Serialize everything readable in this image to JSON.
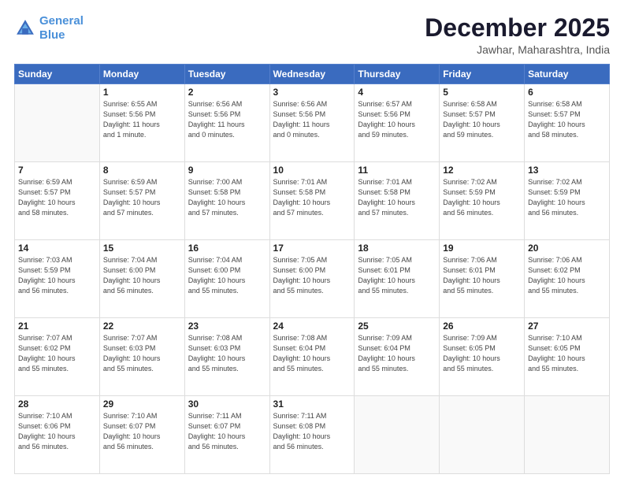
{
  "header": {
    "logo_line1": "General",
    "logo_line2": "Blue",
    "month": "December 2025",
    "location": "Jawhar, Maharashtra, India"
  },
  "weekdays": [
    "Sunday",
    "Monday",
    "Tuesday",
    "Wednesday",
    "Thursday",
    "Friday",
    "Saturday"
  ],
  "weeks": [
    [
      {
        "day": "",
        "detail": ""
      },
      {
        "day": "1",
        "detail": "Sunrise: 6:55 AM\nSunset: 5:56 PM\nDaylight: 11 hours\nand 1 minute."
      },
      {
        "day": "2",
        "detail": "Sunrise: 6:56 AM\nSunset: 5:56 PM\nDaylight: 11 hours\nand 0 minutes."
      },
      {
        "day": "3",
        "detail": "Sunrise: 6:56 AM\nSunset: 5:56 PM\nDaylight: 11 hours\nand 0 minutes."
      },
      {
        "day": "4",
        "detail": "Sunrise: 6:57 AM\nSunset: 5:56 PM\nDaylight: 10 hours\nand 59 minutes."
      },
      {
        "day": "5",
        "detail": "Sunrise: 6:58 AM\nSunset: 5:57 PM\nDaylight: 10 hours\nand 59 minutes."
      },
      {
        "day": "6",
        "detail": "Sunrise: 6:58 AM\nSunset: 5:57 PM\nDaylight: 10 hours\nand 58 minutes."
      }
    ],
    [
      {
        "day": "7",
        "detail": "Sunrise: 6:59 AM\nSunset: 5:57 PM\nDaylight: 10 hours\nand 58 minutes."
      },
      {
        "day": "8",
        "detail": "Sunrise: 6:59 AM\nSunset: 5:57 PM\nDaylight: 10 hours\nand 57 minutes."
      },
      {
        "day": "9",
        "detail": "Sunrise: 7:00 AM\nSunset: 5:58 PM\nDaylight: 10 hours\nand 57 minutes."
      },
      {
        "day": "10",
        "detail": "Sunrise: 7:01 AM\nSunset: 5:58 PM\nDaylight: 10 hours\nand 57 minutes."
      },
      {
        "day": "11",
        "detail": "Sunrise: 7:01 AM\nSunset: 5:58 PM\nDaylight: 10 hours\nand 57 minutes."
      },
      {
        "day": "12",
        "detail": "Sunrise: 7:02 AM\nSunset: 5:59 PM\nDaylight: 10 hours\nand 56 minutes."
      },
      {
        "day": "13",
        "detail": "Sunrise: 7:02 AM\nSunset: 5:59 PM\nDaylight: 10 hours\nand 56 minutes."
      }
    ],
    [
      {
        "day": "14",
        "detail": "Sunrise: 7:03 AM\nSunset: 5:59 PM\nDaylight: 10 hours\nand 56 minutes."
      },
      {
        "day": "15",
        "detail": "Sunrise: 7:04 AM\nSunset: 6:00 PM\nDaylight: 10 hours\nand 56 minutes."
      },
      {
        "day": "16",
        "detail": "Sunrise: 7:04 AM\nSunset: 6:00 PM\nDaylight: 10 hours\nand 55 minutes."
      },
      {
        "day": "17",
        "detail": "Sunrise: 7:05 AM\nSunset: 6:00 PM\nDaylight: 10 hours\nand 55 minutes."
      },
      {
        "day": "18",
        "detail": "Sunrise: 7:05 AM\nSunset: 6:01 PM\nDaylight: 10 hours\nand 55 minutes."
      },
      {
        "day": "19",
        "detail": "Sunrise: 7:06 AM\nSunset: 6:01 PM\nDaylight: 10 hours\nand 55 minutes."
      },
      {
        "day": "20",
        "detail": "Sunrise: 7:06 AM\nSunset: 6:02 PM\nDaylight: 10 hours\nand 55 minutes."
      }
    ],
    [
      {
        "day": "21",
        "detail": "Sunrise: 7:07 AM\nSunset: 6:02 PM\nDaylight: 10 hours\nand 55 minutes."
      },
      {
        "day": "22",
        "detail": "Sunrise: 7:07 AM\nSunset: 6:03 PM\nDaylight: 10 hours\nand 55 minutes."
      },
      {
        "day": "23",
        "detail": "Sunrise: 7:08 AM\nSunset: 6:03 PM\nDaylight: 10 hours\nand 55 minutes."
      },
      {
        "day": "24",
        "detail": "Sunrise: 7:08 AM\nSunset: 6:04 PM\nDaylight: 10 hours\nand 55 minutes."
      },
      {
        "day": "25",
        "detail": "Sunrise: 7:09 AM\nSunset: 6:04 PM\nDaylight: 10 hours\nand 55 minutes."
      },
      {
        "day": "26",
        "detail": "Sunrise: 7:09 AM\nSunset: 6:05 PM\nDaylight: 10 hours\nand 55 minutes."
      },
      {
        "day": "27",
        "detail": "Sunrise: 7:10 AM\nSunset: 6:05 PM\nDaylight: 10 hours\nand 55 minutes."
      }
    ],
    [
      {
        "day": "28",
        "detail": "Sunrise: 7:10 AM\nSunset: 6:06 PM\nDaylight: 10 hours\nand 56 minutes."
      },
      {
        "day": "29",
        "detail": "Sunrise: 7:10 AM\nSunset: 6:07 PM\nDaylight: 10 hours\nand 56 minutes."
      },
      {
        "day": "30",
        "detail": "Sunrise: 7:11 AM\nSunset: 6:07 PM\nDaylight: 10 hours\nand 56 minutes."
      },
      {
        "day": "31",
        "detail": "Sunrise: 7:11 AM\nSunset: 6:08 PM\nDaylight: 10 hours\nand 56 minutes."
      },
      {
        "day": "",
        "detail": ""
      },
      {
        "day": "",
        "detail": ""
      },
      {
        "day": "",
        "detail": ""
      }
    ]
  ]
}
